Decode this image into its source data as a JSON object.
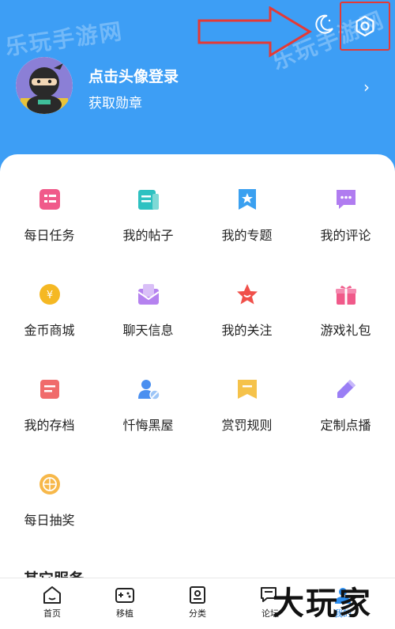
{
  "header": {
    "login_title": "点击头像登录",
    "login_subtitle": "获取勋章",
    "watermark": "乐玩手游网"
  },
  "grid": [
    {
      "label": "每日任务",
      "icon": "task-list-icon",
      "color": "#f05a8a"
    },
    {
      "label": "我的帖子",
      "icon": "posts-icon",
      "color": "#2ec1c1"
    },
    {
      "label": "我的专题",
      "icon": "topic-bookmark-icon",
      "color": "#3aa0f0"
    },
    {
      "label": "我的评论",
      "icon": "comment-icon",
      "color": "#b07cf0"
    },
    {
      "label": "金币商城",
      "icon": "gold-coin-icon",
      "color": "#f5b823"
    },
    {
      "label": "聊天信息",
      "icon": "chat-envelope-icon",
      "color": "#b582ef"
    },
    {
      "label": "我的关注",
      "icon": "star-icon",
      "color": "#f0504a"
    },
    {
      "label": "游戏礼包",
      "icon": "gift-icon",
      "color": "#f05a8a"
    },
    {
      "label": "我的存档",
      "icon": "archive-icon",
      "color": "#f06b6b"
    },
    {
      "label": "忏悔黑屋",
      "icon": "user-block-icon",
      "color": "#4a8ff0"
    },
    {
      "label": "赏罚规则",
      "icon": "rules-flag-icon",
      "color": "#f5c24a"
    },
    {
      "label": "定制点播",
      "icon": "pencil-icon",
      "color": "#9a7ef5"
    },
    {
      "label": "每日抽奖",
      "icon": "lottery-wheel-icon",
      "color": "#f7b84a"
    }
  ],
  "other_services_title": "其它服务",
  "tabs": [
    {
      "label": "首页",
      "icon": "home-icon"
    },
    {
      "label": "移植",
      "icon": "gamepad-icon"
    },
    {
      "label": "分类",
      "icon": "category-icon"
    },
    {
      "label": "论坛",
      "icon": "forum-icon"
    },
    {
      "label": "我的",
      "icon": "profile-icon"
    }
  ],
  "active_tab": 4,
  "brand_watermark": "大玩家"
}
